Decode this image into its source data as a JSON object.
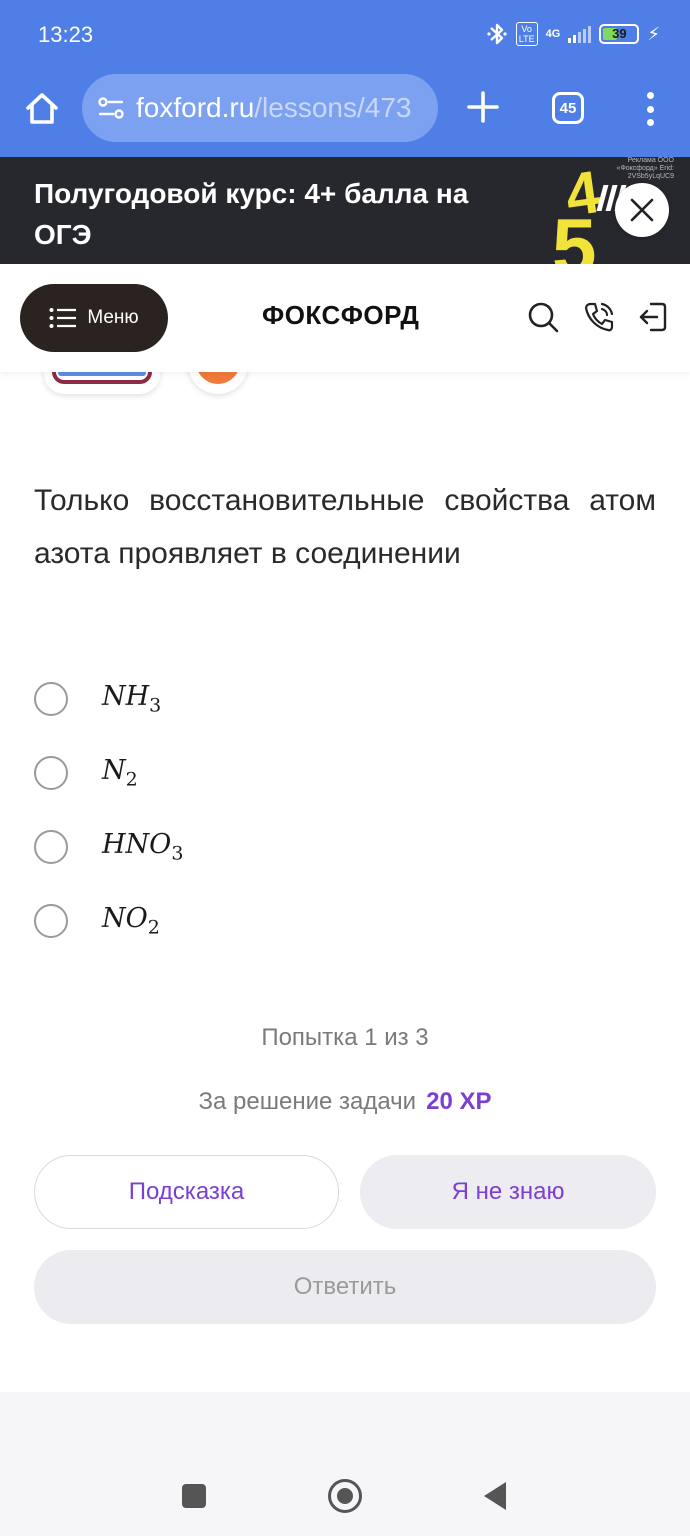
{
  "status_bar": {
    "time": "13:23",
    "volte_label": "Vo LTE",
    "network": "4G",
    "battery": "39",
    "battery_level": 0.39,
    "icons": [
      "bluetooth-icon",
      "volte-icon",
      "signal-icon",
      "battery-icon",
      "charging-icon"
    ]
  },
  "browser": {
    "url_domain": "foxford.ru",
    "url_path": "/lessons/473",
    "tab_count": "45",
    "accent": "#4f7fe6"
  },
  "ad": {
    "title": "Полугодовой курс: 4+ балла на ОГЭ",
    "label": "Реклама ООО «Фоксфорд» Erid: 2VSb5yLqUC9",
    "digit_top": "4",
    "digit_bottom": "5"
  },
  "header": {
    "menu_label": "Меню",
    "logo": "ФОКСФОРД"
  },
  "task": {
    "question": "Только восстановительные свойства атом азота проявляет в соединении",
    "options": [
      {
        "main": "NH",
        "sub": "3"
      },
      {
        "main": "N",
        "sub": "2"
      },
      {
        "main": "HNO",
        "sub": "3"
      },
      {
        "main": "NO",
        "sub": "2"
      }
    ],
    "attempt": "Попытка 1 из 3",
    "reward_label": "За решение задачи",
    "reward_xp": "20 XP",
    "hint_button": "Подсказка",
    "dontknow_button": "Я не знаю",
    "answer_button": "Ответить",
    "accent": "#7b3fd1"
  }
}
